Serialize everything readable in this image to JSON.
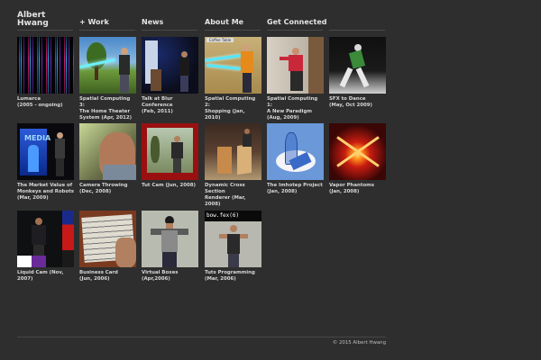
{
  "site_title": [
    "Albert",
    "Hwang"
  ],
  "nav": [
    {
      "label": "+ Work"
    },
    {
      "label": "News"
    },
    {
      "label": "About Me"
    },
    {
      "label": "Get Connected"
    }
  ],
  "tiles": [
    {
      "title": "Lumarca",
      "sub": "(2005 - ongoing)"
    },
    {
      "title": "Spatial Computing 3:",
      "sub": "The Home Theater",
      "sub2": "System (Apr, 2012)"
    },
    {
      "title": "Talk at Blur Conference",
      "sub": "(Feb, 2011)"
    },
    {
      "title": "Spatial Computing 2:",
      "sub": "Shopping (Jan, 2010)"
    },
    {
      "title": "Spatial Computing 1:",
      "sub": "A New Paradigm",
      "sub2": "(Aug, 2009)"
    },
    {
      "title": "SFX to Dance",
      "sub": "(May, Oct 2009)"
    },
    {
      "title": "The Market Value of",
      "sub": "Monkeys and Robots",
      "sub2": "(Mar, 2009)"
    },
    {
      "title": "Camera Throwing",
      "sub": "(Dec, 2008)"
    },
    {
      "title": "Tut Cam (Jun, 2008)"
    },
    {
      "title": "Dynamic Cross Section",
      "sub": "Renderer (Mar, 2008)"
    },
    {
      "title": "The Imhotep Project",
      "sub": "(Jan, 2008)"
    },
    {
      "title": "Vapor Phantoms",
      "sub": "(Jan, 2008)"
    },
    {
      "title": "Liquid Cam (Nov, 2007)"
    },
    {
      "title": "Business Card",
      "sub": "(Jun, 2006)"
    },
    {
      "title": "Virtual Boxes",
      "sub": "(Apr,2006)"
    },
    {
      "title": "Tuts Programming",
      "sub": "(Mar, 2006)"
    }
  ],
  "thumb_text": {
    "coffee_table": "Coffee Table",
    "media_wall": "MEDIA",
    "code": "bow.fex(6)"
  },
  "footer": "© 2015 Albert Hwang",
  "colors": {
    "background": "#2e2e2e",
    "text": "#e4e4e4"
  }
}
